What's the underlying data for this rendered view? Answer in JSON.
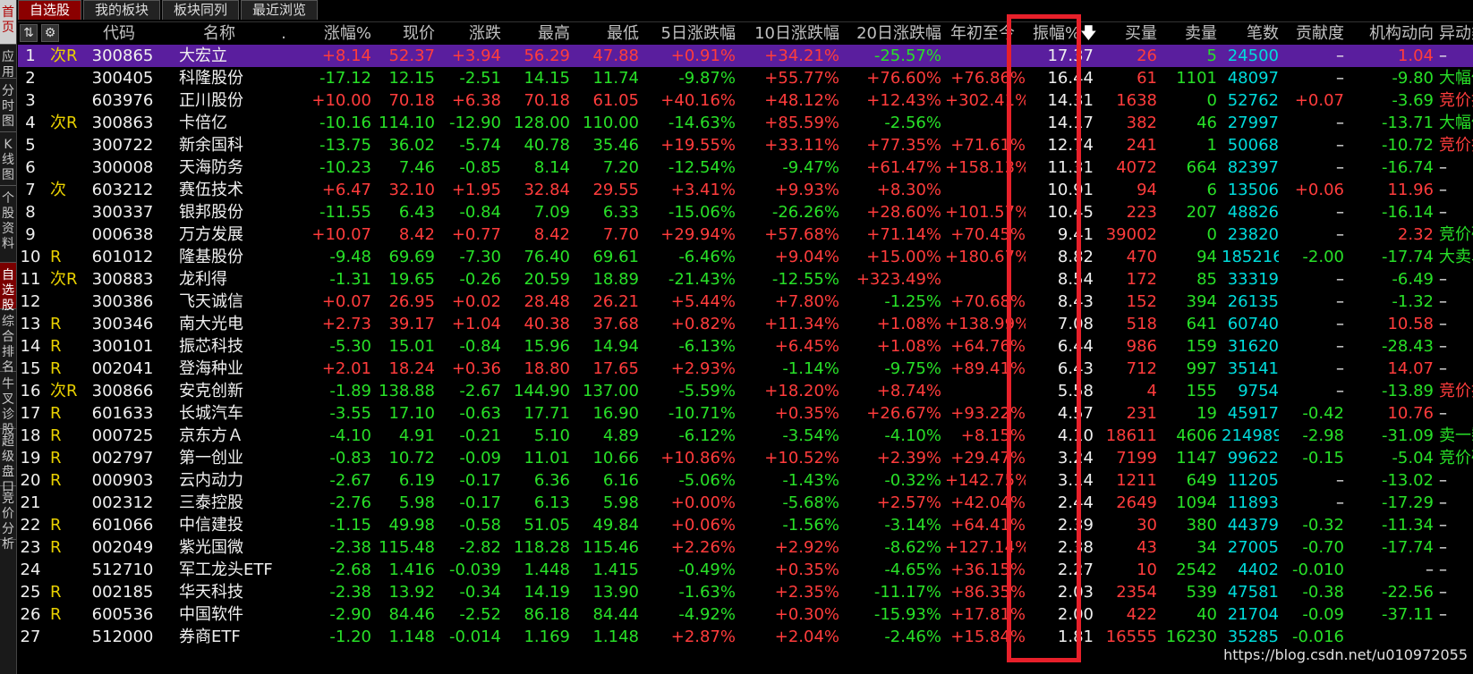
{
  "left_tabs": [
    "首页",
    "应用",
    "分时图",
    "K线图",
    "个股资料",
    "自选股",
    "综合排名",
    "牛叉诊股",
    "超级盘口",
    "竞价分析"
  ],
  "tabs": [
    "自选股",
    "我的板块",
    "板块同列",
    "最近浏览"
  ],
  "header": {
    "code": "代码",
    "name": "名称",
    "dot": ".",
    "pct": "涨幅%",
    "price": "现价",
    "chg": "涨跌",
    "high": "最高",
    "low": "最低",
    "d5": "5日涨跌幅",
    "d10": "10日涨跌幅",
    "d20": "20日涨跌幅",
    "ytd": "年初至今",
    "amp": "振幅%",
    "amp_arrow": "🡇",
    "buy": "买量",
    "sell": "卖量",
    "deals": "笔数",
    "contrib": "贡献度",
    "inst": "机构动向",
    "alert": "异动类"
  },
  "rows": [
    {
      "no": "1",
      "flag": "次R",
      "code": "300865",
      "name": "大宏立",
      "pct": "+8.14",
      "price": "52.37",
      "chg": "+3.94",
      "high": "56.29",
      "low": "47.88",
      "d5": "+0.91%",
      "d10": "+34.21%",
      "d20": "-25.57%",
      "ytd": "",
      "amp": "17.37",
      "buy": "26",
      "sell": "5",
      "deals": "24500",
      "contrib": "–",
      "inst": "1.04",
      "alert": "–"
    },
    {
      "no": "2",
      "flag": "",
      "code": "300405",
      "name": "科隆股份",
      "pct": "-17.12",
      "price": "12.15",
      "chg": "-2.51",
      "high": "14.15",
      "low": "11.74",
      "d5": "-9.87%",
      "d10": "+55.77%",
      "d20": "+76.60%",
      "ytd": "+76.86%",
      "amp": "16.44",
      "buy": "61",
      "sell": "1101",
      "deals": "48097",
      "contrib": "–",
      "inst": "-9.80",
      "alert": "大幅低"
    },
    {
      "no": "3",
      "flag": "",
      "code": "603976",
      "name": "正川股份",
      "pct": "+10.00",
      "price": "70.18",
      "chg": "+6.38",
      "high": "70.18",
      "low": "61.05",
      "d5": "+40.16%",
      "d10": "+48.12%",
      "d20": "+12.43%",
      "ytd": "+302.41%",
      "amp": "14.31",
      "buy": "1638",
      "sell": "0",
      "deals": "52762",
      "contrib": "+0.07",
      "inst": "-3.69",
      "alert": "竞价抢"
    },
    {
      "no": "4",
      "flag": "次R",
      "code": "300863",
      "name": "卡倍亿",
      "pct": "-10.16",
      "price": "114.10",
      "chg": "-12.90",
      "high": "128.00",
      "low": "110.00",
      "d5": "-14.63%",
      "d10": "+85.59%",
      "d20": "-2.56%",
      "ytd": "",
      "amp": "14.17",
      "buy": "382",
      "sell": "46",
      "deals": "27997",
      "contrib": "–",
      "inst": "-13.71",
      "alert": "大幅低"
    },
    {
      "no": "5",
      "flag": "",
      "code": "300722",
      "name": "新余国科",
      "pct": "-13.75",
      "price": "36.02",
      "chg": "-5.74",
      "high": "40.78",
      "low": "35.46",
      "d5": "+19.55%",
      "d10": "+33.11%",
      "d20": "+77.35%",
      "ytd": "+71.61%",
      "amp": "12.74",
      "buy": "241",
      "sell": "1",
      "deals": "50068",
      "contrib": "–",
      "inst": "-10.72",
      "alert": "竞价抢"
    },
    {
      "no": "6",
      "flag": "",
      "code": "300008",
      "name": "天海防务",
      "pct": "-10.23",
      "price": "7.46",
      "chg": "-0.85",
      "high": "8.14",
      "low": "7.20",
      "d5": "-12.54%",
      "d10": "-9.47%",
      "d20": "+61.47%",
      "ytd": "+158.13%",
      "amp": "11.31",
      "buy": "4072",
      "sell": "664",
      "deals": "82397",
      "contrib": "–",
      "inst": "-16.74",
      "alert": "–"
    },
    {
      "no": "7",
      "flag": "次",
      "code": "603212",
      "name": "赛伍技术",
      "pct": "+6.47",
      "price": "32.10",
      "chg": "+1.95",
      "high": "32.84",
      "low": "29.55",
      "d5": "+3.41%",
      "d10": "+9.93%",
      "d20": "+8.30%",
      "ytd": "",
      "amp": "10.91",
      "buy": "94",
      "sell": "6",
      "deals": "13506",
      "contrib": "+0.06",
      "inst": "11.96",
      "alert": "–"
    },
    {
      "no": "8",
      "flag": "",
      "code": "300337",
      "name": "银邦股份",
      "pct": "-11.55",
      "price": "6.43",
      "chg": "-0.84",
      "high": "7.09",
      "low": "6.33",
      "d5": "-15.06%",
      "d10": "-26.26%",
      "d20": "+28.60%",
      "ytd": "+101.57%",
      "amp": "10.45",
      "buy": "223",
      "sell": "207",
      "deals": "48826",
      "contrib": "–",
      "inst": "-16.14",
      "alert": "–"
    },
    {
      "no": "9",
      "flag": "",
      "code": "000638",
      "name": "万方发展",
      "pct": "+10.07",
      "price": "8.42",
      "chg": "+0.77",
      "high": "8.42",
      "low": "7.70",
      "d5": "+29.94%",
      "d10": "+57.68%",
      "d20": "+71.14%",
      "ytd": "+70.45%",
      "amp": "9.41",
      "buy": "39002",
      "sell": "0",
      "deals": "23820",
      "contrib": "–",
      "inst": "2.32",
      "alert": "竞价砸"
    },
    {
      "no": "10",
      "flag": "R",
      "code": "601012",
      "name": "隆基股份",
      "pct": "-9.48",
      "price": "69.69",
      "chg": "-7.30",
      "high": "76.40",
      "low": "69.61",
      "d5": "-6.46%",
      "d10": "+9.04%",
      "d20": "+15.00%",
      "ytd": "+180.67%",
      "amp": "8.82",
      "buy": "470",
      "sell": "94",
      "deals": "185216",
      "contrib": "-2.00",
      "inst": "-17.74",
      "alert": "大卖单"
    },
    {
      "no": "11",
      "flag": "次R",
      "code": "300883",
      "name": "龙利得",
      "pct": "-1.31",
      "price": "19.65",
      "chg": "-0.26",
      "high": "20.59",
      "low": "18.89",
      "d5": "-21.43%",
      "d10": "-12.55%",
      "d20": "+323.49%",
      "ytd": "",
      "amp": "8.54",
      "buy": "172",
      "sell": "85",
      "deals": "33319",
      "contrib": "–",
      "inst": "-6.49",
      "alert": "–"
    },
    {
      "no": "12",
      "flag": "",
      "code": "300386",
      "name": "飞天诚信",
      "pct": "+0.07",
      "price": "26.95",
      "chg": "+0.02",
      "high": "28.48",
      "low": "26.21",
      "d5": "+5.44%",
      "d10": "+7.80%",
      "d20": "-1.25%",
      "ytd": "+70.68%",
      "amp": "8.43",
      "buy": "152",
      "sell": "394",
      "deals": "26135",
      "contrib": "–",
      "inst": "-1.32",
      "alert": "–"
    },
    {
      "no": "13",
      "flag": "R",
      "code": "300346",
      "name": "南大光电",
      "pct": "+2.73",
      "price": "39.17",
      "chg": "+1.04",
      "high": "40.38",
      "low": "37.68",
      "d5": "+0.82%",
      "d10": "+11.34%",
      "d20": "+1.08%",
      "ytd": "+138.99%",
      "amp": "7.08",
      "buy": "518",
      "sell": "641",
      "deals": "60740",
      "contrib": "–",
      "inst": "10.58",
      "alert": "–"
    },
    {
      "no": "14",
      "flag": "R",
      "code": "300101",
      "name": "振芯科技",
      "pct": "-5.30",
      "price": "15.01",
      "chg": "-0.84",
      "high": "15.96",
      "low": "14.94",
      "d5": "-6.13%",
      "d10": "+6.45%",
      "d20": "+1.08%",
      "ytd": "+64.76%",
      "amp": "6.44",
      "buy": "986",
      "sell": "159",
      "deals": "31620",
      "contrib": "–",
      "inst": "-28.43",
      "alert": "–"
    },
    {
      "no": "15",
      "flag": "R",
      "code": "002041",
      "name": "登海种业",
      "pct": "+2.01",
      "price": "18.24",
      "chg": "+0.36",
      "high": "18.80",
      "low": "17.65",
      "d5": "+2.93%",
      "d10": "-1.14%",
      "d20": "-9.75%",
      "ytd": "+89.41%",
      "amp": "6.43",
      "buy": "712",
      "sell": "997",
      "deals": "35141",
      "contrib": "–",
      "inst": "14.07",
      "alert": "–"
    },
    {
      "no": "16",
      "flag": "次R",
      "code": "300866",
      "name": "安克创新",
      "pct": "-1.89",
      "price": "138.88",
      "chg": "-2.67",
      "high": "144.90",
      "low": "137.00",
      "d5": "-5.59%",
      "d10": "+18.20%",
      "d20": "+8.74%",
      "ytd": "",
      "amp": "5.58",
      "buy": "4",
      "sell": "155",
      "deals": "9754",
      "contrib": "–",
      "inst": "-13.89",
      "alert": "竞价抢"
    },
    {
      "no": "17",
      "flag": "R",
      "code": "601633",
      "name": "长城汽车",
      "pct": "-3.55",
      "price": "17.10",
      "chg": "-0.63",
      "high": "17.71",
      "low": "16.90",
      "d5": "-10.71%",
      "d10": "+0.35%",
      "d20": "+26.67%",
      "ytd": "+93.22%",
      "amp": "4.57",
      "buy": "231",
      "sell": "19",
      "deals": "45917",
      "contrib": "-0.42",
      "inst": "10.76",
      "alert": "–"
    },
    {
      "no": "18",
      "flag": "R",
      "code": "000725",
      "name": "京东方Ａ",
      "pct": "-4.10",
      "price": "4.91",
      "chg": "-0.21",
      "high": "5.10",
      "low": "4.89",
      "d5": "-6.12%",
      "d10": "-3.54%",
      "d20": "-4.10%",
      "ytd": "+8.15%",
      "amp": "4.10",
      "buy": "18611",
      "sell": "4606",
      "deals": "214989",
      "contrib": "-2.98",
      "inst": "-31.09",
      "alert": "卖一黏"
    },
    {
      "no": "19",
      "flag": "R",
      "code": "002797",
      "name": "第一创业",
      "pct": "-0.83",
      "price": "10.72",
      "chg": "-0.09",
      "high": "11.01",
      "low": "10.66",
      "d5": "+10.86%",
      "d10": "+10.52%",
      "d20": "+2.39%",
      "ytd": "+29.47%",
      "amp": "3.24",
      "buy": "7199",
      "sell": "1147",
      "deals": "99622",
      "contrib": "-0.15",
      "inst": "-5.04",
      "alert": "竞价砸"
    },
    {
      "no": "20",
      "flag": "R",
      "code": "000903",
      "name": "云内动力",
      "pct": "-2.67",
      "price": "6.19",
      "chg": "-0.17",
      "high": "6.36",
      "low": "6.16",
      "d5": "-5.06%",
      "d10": "-1.43%",
      "d20": "-0.32%",
      "ytd": "+142.75%",
      "amp": "3.14",
      "buy": "1211",
      "sell": "649",
      "deals": "11205",
      "contrib": "–",
      "inst": "-13.02",
      "alert": "–"
    },
    {
      "no": "21",
      "flag": "",
      "code": "002312",
      "name": "三泰控股",
      "pct": "-2.76",
      "price": "5.98",
      "chg": "-0.17",
      "high": "6.13",
      "low": "5.98",
      "d5": "+0.00%",
      "d10": "-5.68%",
      "d20": "+2.57%",
      "ytd": "+42.04%",
      "amp": "2.44",
      "buy": "2649",
      "sell": "1094",
      "deals": "11893",
      "contrib": "–",
      "inst": "-17.29",
      "alert": "–"
    },
    {
      "no": "22",
      "flag": "R",
      "code": "601066",
      "name": "中信建投",
      "pct": "-1.15",
      "price": "49.98",
      "chg": "-0.58",
      "high": "51.05",
      "low": "49.84",
      "d5": "+0.06%",
      "d10": "-1.56%",
      "d20": "-3.14%",
      "ytd": "+64.41%",
      "amp": "2.39",
      "buy": "30",
      "sell": "380",
      "deals": "44379",
      "contrib": "-0.32",
      "inst": "-11.34",
      "alert": "–"
    },
    {
      "no": "23",
      "flag": "R",
      "code": "002049",
      "name": "紫光国微",
      "pct": "-2.38",
      "price": "115.48",
      "chg": "-2.82",
      "high": "118.28",
      "low": "115.46",
      "d5": "+2.26%",
      "d10": "+2.92%",
      "d20": "-8.62%",
      "ytd": "+127.14%",
      "amp": "2.38",
      "buy": "43",
      "sell": "34",
      "deals": "27005",
      "contrib": "-0.70",
      "inst": "-17.74",
      "alert": "–"
    },
    {
      "no": "24",
      "flag": "",
      "code": "512710",
      "name": "军工龙头ETF",
      "pct": "-2.68",
      "price": "1.416",
      "chg": "-0.039",
      "high": "1.448",
      "low": "1.415",
      "d5": "-0.49%",
      "d10": "+0.35%",
      "d20": "-4.65%",
      "ytd": "+36.15%",
      "amp": "2.27",
      "buy": "10",
      "sell": "2542",
      "deals": "4402",
      "contrib": "-0.010",
      "inst": "–",
      "alert": "–"
    },
    {
      "no": "25",
      "flag": "R",
      "code": "002185",
      "name": "华天科技",
      "pct": "-2.38",
      "price": "13.92",
      "chg": "-0.34",
      "high": "14.19",
      "low": "13.90",
      "d5": "-1.63%",
      "d10": "+2.35%",
      "d20": "-11.17%",
      "ytd": "+86.35%",
      "amp": "2.03",
      "buy": "2354",
      "sell": "539",
      "deals": "47581",
      "contrib": "-0.38",
      "inst": "-22.56",
      "alert": "–"
    },
    {
      "no": "26",
      "flag": "R",
      "code": "600536",
      "name": "中国软件",
      "pct": "-2.90",
      "price": "84.46",
      "chg": "-2.52",
      "high": "86.18",
      "low": "84.44",
      "d5": "-4.92%",
      "d10": "+0.30%",
      "d20": "-15.93%",
      "ytd": "+17.81%",
      "amp": "2.00",
      "buy": "422",
      "sell": "40",
      "deals": "21704",
      "contrib": "-0.09",
      "inst": "-37.11",
      "alert": "–"
    },
    {
      "no": "27",
      "flag": "",
      "code": "512000",
      "name": "券商ETF",
      "pct": "-1.20",
      "price": "1.148",
      "chg": "-0.014",
      "high": "1.169",
      "low": "1.148",
      "d5": "+2.87%",
      "d10": "+2.04%",
      "d20": "-2.46%",
      "ytd": "+15.84%",
      "amp": "1.81",
      "buy": "16555",
      "sell": "16230",
      "deals": "35285",
      "contrib": "-0.016",
      "inst": "",
      "alert": ""
    }
  ],
  "watermark": "https://blog.csdn.net/u010972055",
  "colors": {
    "up": "#ff3c3c",
    "down": "#28e028",
    "highlight": "#5a1e9e",
    "box": "#e8202a"
  }
}
